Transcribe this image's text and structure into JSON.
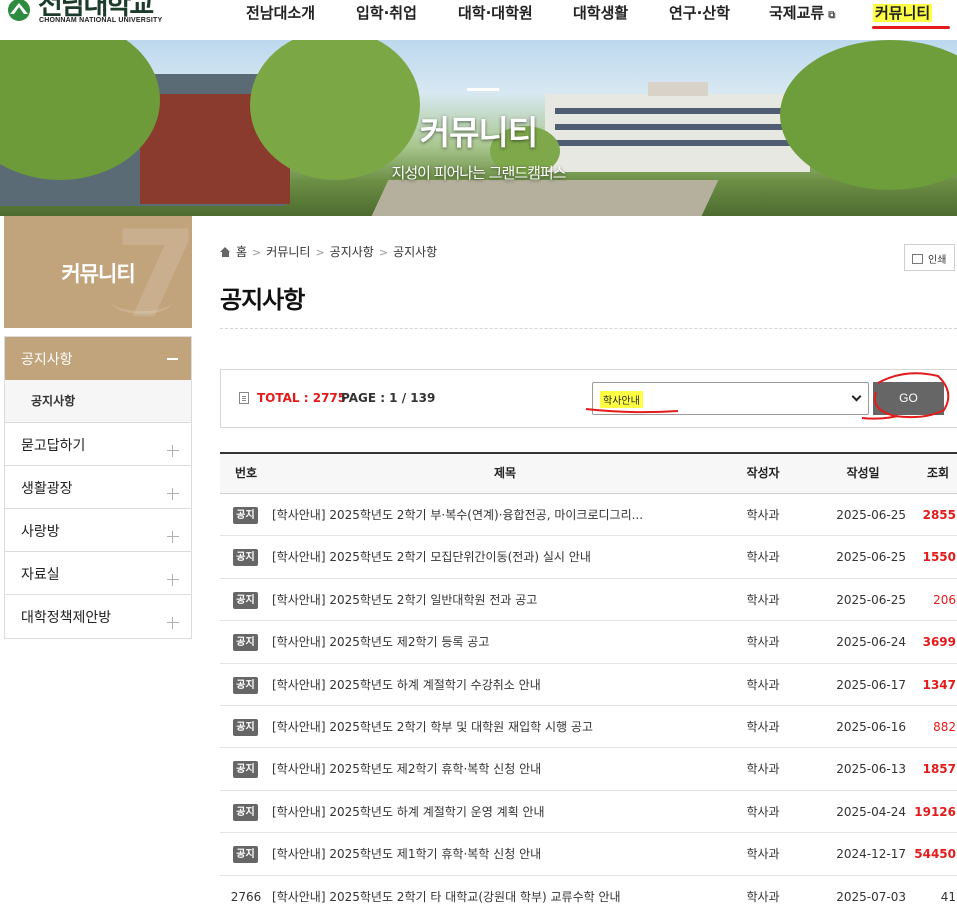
{
  "header": {
    "logo_ko": "전남대학교",
    "logo_en": "CHONNAM NATIONAL UNIVERSITY",
    "nav": [
      {
        "label": "전남대소개"
      },
      {
        "label": "입학·취업"
      },
      {
        "label": "대학·대학원"
      },
      {
        "label": "대학생활"
      },
      {
        "label": "연구·산학"
      },
      {
        "label": "국제교류"
      },
      {
        "label": "커뮤니티"
      }
    ],
    "ext_icon": "external-link-icon"
  },
  "banner": {
    "title": "커뮤니티",
    "subtitle": "지성이 피어나는 그랜드캠퍼스"
  },
  "sidebar": {
    "heading": "커뮤니티",
    "active": "공지사항",
    "active_sub": "공지사항",
    "items": [
      {
        "label": "묻고답하기"
      },
      {
        "label": "생활광장"
      },
      {
        "label": "사랑방"
      },
      {
        "label": "자료실"
      },
      {
        "label": "대학정책제안방"
      }
    ]
  },
  "breadcrumb": [
    "홈",
    "커뮤니티",
    "공지사항",
    "공지사항"
  ],
  "print_label": "인쇄",
  "page_title": "공지사항",
  "search": {
    "total": "TOTAL : 2775",
    "page": "PAGE : 1  / 139",
    "selected": "학사안내",
    "go": "GO"
  },
  "table": {
    "headers": {
      "no": "번호",
      "title": "제목",
      "author": "작성자",
      "date": "작성일",
      "views": "조회"
    },
    "notice_badge": "공지",
    "rows": [
      {
        "no": "",
        "notice": true,
        "title": "[학사안내] 2025학년도 2학기 부·복수(연계)·융합전공, 마이크로디그리...",
        "author": "학사과",
        "date": "2025-06-25",
        "views": "2855",
        "hot": true
      },
      {
        "no": "",
        "notice": true,
        "title": "[학사안내] 2025학년도 2학기 모집단위간이동(전과) 실시 안내",
        "author": "학사과",
        "date": "2025-06-25",
        "views": "1550",
        "hot": true
      },
      {
        "no": "",
        "notice": true,
        "title": "[학사안내] 2025학년도 2학기 일반대학원 전과 공고",
        "author": "학사과",
        "date": "2025-06-25",
        "views": "206",
        "hot": false
      },
      {
        "no": "",
        "notice": true,
        "title": "[학사안내] 2025학년도 제2학기 등록 공고",
        "author": "학사과",
        "date": "2025-06-24",
        "views": "3699",
        "hot": true
      },
      {
        "no": "",
        "notice": true,
        "title": "[학사안내] 2025학년도 하계 계절학기 수강취소 안내",
        "author": "학사과",
        "date": "2025-06-17",
        "views": "1347",
        "hot": true
      },
      {
        "no": "",
        "notice": true,
        "title": "[학사안내] 2025학년도 2학기 학부 및 대학원 재입학 시행 공고",
        "author": "학사과",
        "date": "2025-06-16",
        "views": "882",
        "hot": false
      },
      {
        "no": "",
        "notice": true,
        "title": "[학사안내] 2025학년도 제2학기 휴학·복학 신청 안내",
        "author": "학사과",
        "date": "2025-06-13",
        "views": "1857",
        "hot": true
      },
      {
        "no": "",
        "notice": true,
        "title": "[학사안내] 2025학년도 하계 계절학기 운영 계획 안내",
        "author": "학사과",
        "date": "2025-04-24",
        "views": "19126",
        "hot": true
      },
      {
        "no": "",
        "notice": true,
        "title": "[학사안내] 2025학년도 제1학기 휴학·복학 신청 안내",
        "author": "학사과",
        "date": "2024-12-17",
        "views": "54450",
        "hot": true
      },
      {
        "no": "2766",
        "notice": false,
        "title": "[학사안내] 2025학년도 2학기 타 대학교(강원대 학부) 교류수학 안내",
        "author": "학사과",
        "date": "2025-07-03",
        "views": "41",
        "hot": false
      }
    ]
  },
  "colors": {
    "accent": "#c2a47c",
    "hot": "#e31b1b",
    "highlight": "#ffff44",
    "go": "#666666"
  }
}
